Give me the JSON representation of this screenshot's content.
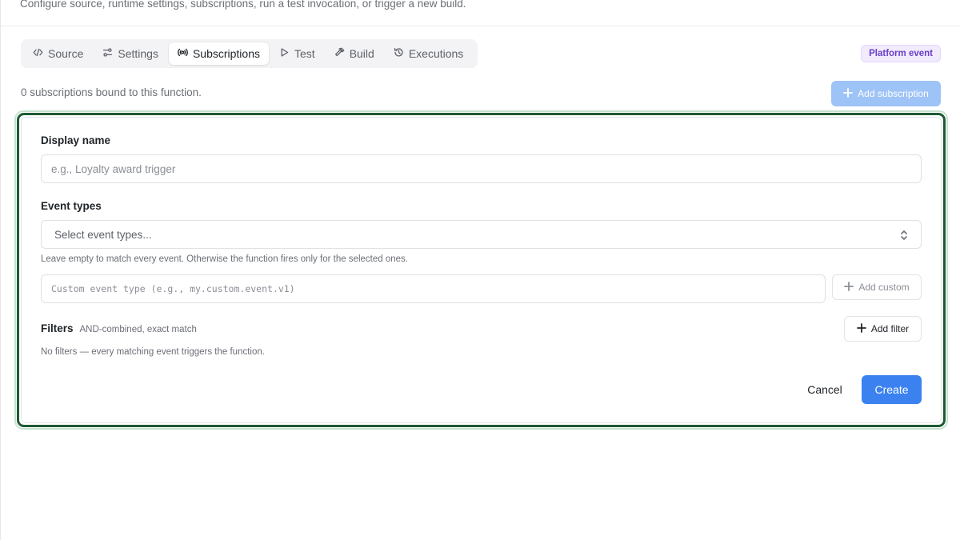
{
  "header": {
    "subtitle": "Configure source, runtime settings, subscriptions, run a test invocation, or trigger a new build."
  },
  "tabs": [
    {
      "label": "Source",
      "icon": "code-icon"
    },
    {
      "label": "Settings",
      "icon": "sliders-icon"
    },
    {
      "label": "Subscriptions",
      "icon": "broadcast-icon",
      "active": true
    },
    {
      "label": "Test",
      "icon": "play-icon"
    },
    {
      "label": "Build",
      "icon": "hammer-icon"
    },
    {
      "label": "Executions",
      "icon": "history-icon"
    }
  ],
  "badge": {
    "label": "Platform event",
    "color": "#6a3fc8"
  },
  "subscriptions": {
    "count_text": "0 subscriptions bound to this function.",
    "add_label": "Add subscription"
  },
  "form": {
    "display_name_label": "Display name",
    "display_name_placeholder": "e.g., Loyalty award trigger",
    "event_types_label": "Event types",
    "event_types_placeholder": "Select event types...",
    "event_types_help": "Leave empty to match every event. Otherwise the function fires only for the selected ones.",
    "custom_event_placeholder": "Custom event type (e.g., my.custom.event.v1)",
    "add_custom_label": "Add custom",
    "filters_label": "Filters",
    "filters_sub": "AND-combined, exact match",
    "add_filter_label": "Add filter",
    "filters_empty": "No filters — every matching event triggers the function.",
    "cancel_label": "Cancel",
    "create_label": "Create"
  },
  "colors": {
    "accent": "#3b82f0",
    "focus_ring": "#1e5a33"
  }
}
